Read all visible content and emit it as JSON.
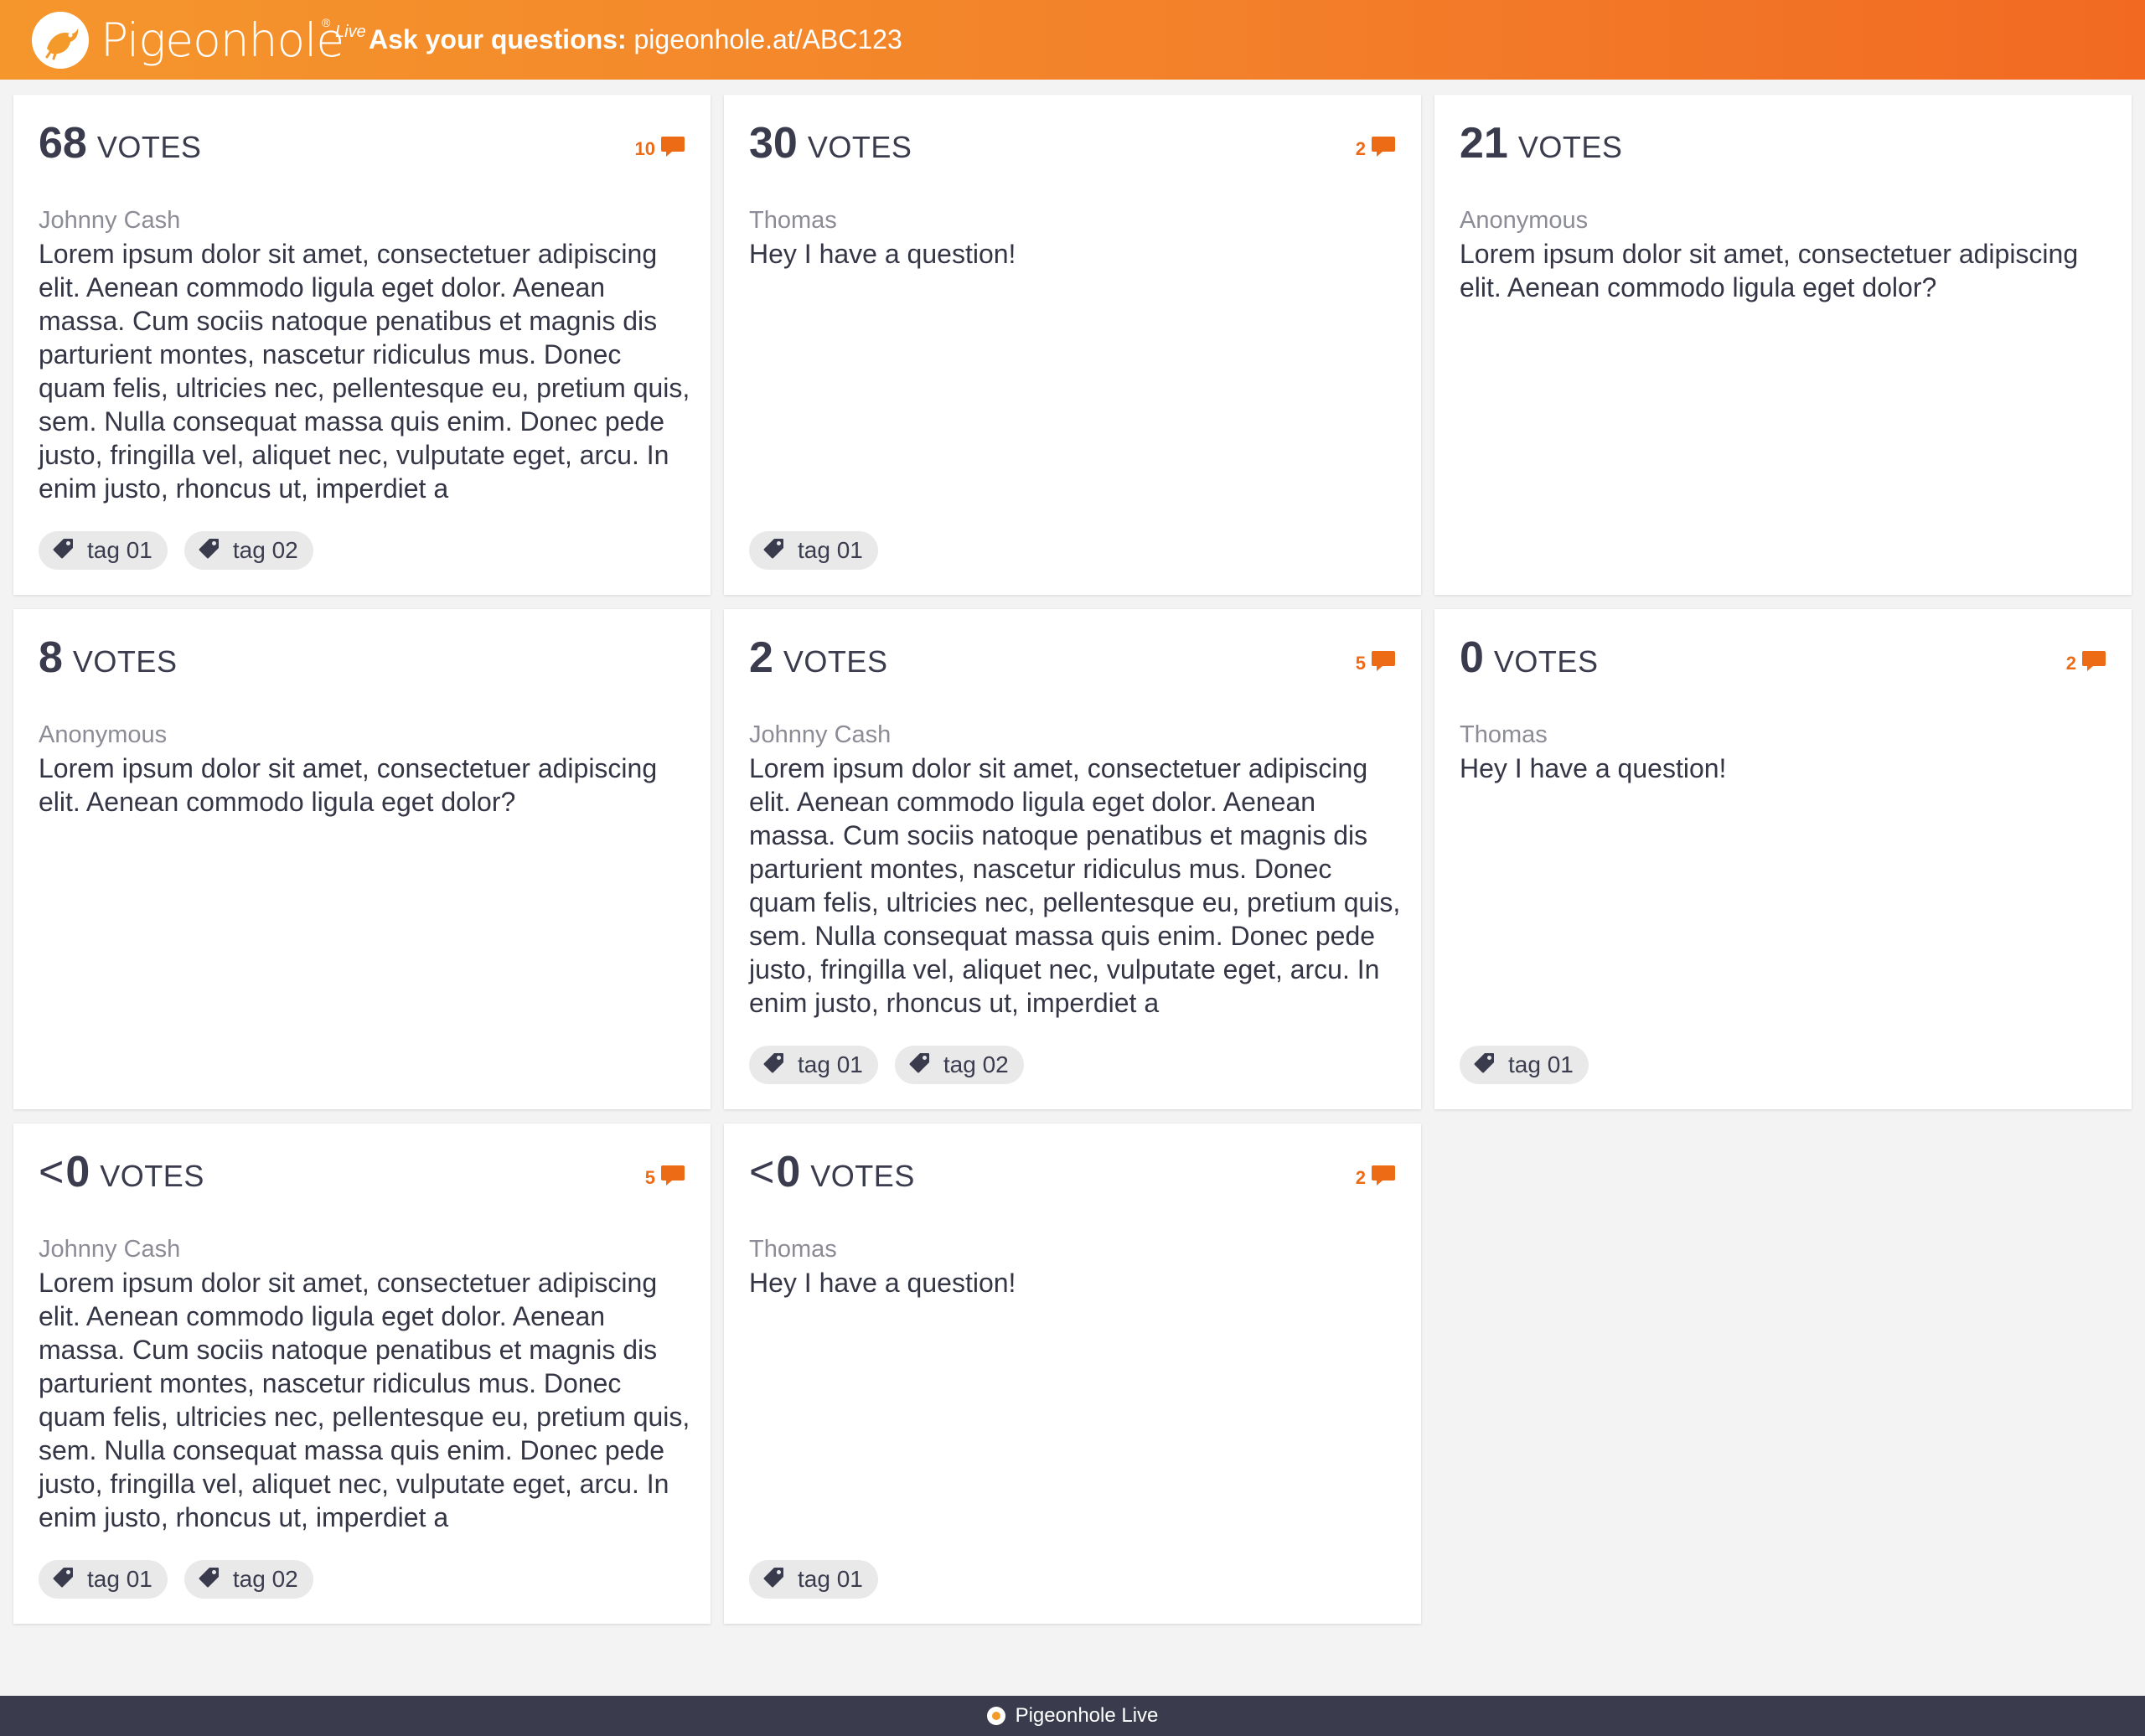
{
  "header": {
    "brand": "Pigeonhole",
    "brand_registered": "®",
    "brand_suffix": "Live",
    "ask_label": "Ask your questions:",
    "ask_url": "pigeonhole.at/ABC123"
  },
  "colors": {
    "header_gradient_start": "#f5962c",
    "header_gradient_end": "#f26a22",
    "accent": "#ee6b16",
    "footer": "#3a3c4e",
    "background": "#f3f3f3"
  },
  "votes_label": "VOTES",
  "cards": [
    {
      "prefix": "",
      "votes": "68",
      "comments": "10",
      "author": "Johnny Cash",
      "text": "Lorem ipsum dolor sit amet, consectetuer adipiscing elit. Aenean commodo ligula eget dolor. Aenean massa. Cum sociis natoque penatibus et magnis dis parturient montes, nascetur ridiculus mus. Donec quam felis, ultricies nec, pellentesque eu, pretium quis, sem. Nulla consequat massa quis enim. Donec pede justo, fringilla vel, aliquet nec, vulputate eget, arcu. In enim justo, rhoncus ut, imperdiet a",
      "tags": [
        "tag 01",
        "tag 02"
      ]
    },
    {
      "prefix": "",
      "votes": "30",
      "comments": "2",
      "author": "Thomas",
      "text": "Hey I have a question!",
      "tags": [
        "tag 01"
      ]
    },
    {
      "prefix": "",
      "votes": "21",
      "comments": "",
      "author": "Anonymous",
      "text": "Lorem ipsum dolor sit amet, consectetuer adipiscing elit. Aenean commodo ligula eget dolor?",
      "tags": []
    },
    {
      "prefix": "",
      "votes": "8",
      "comments": "",
      "author": "Anonymous",
      "text": "Lorem ipsum dolor sit amet, consectetuer adipiscing elit. Aenean commodo ligula eget dolor?",
      "tags": []
    },
    {
      "prefix": "",
      "votes": "2",
      "comments": "5",
      "author": "Johnny Cash",
      "text": "Lorem ipsum dolor sit amet, consectetuer adipiscing elit. Aenean commodo ligula eget dolor. Aenean massa. Cum sociis natoque penatibus et magnis dis parturient montes, nascetur ridiculus mus. Donec quam felis, ultricies nec, pellentesque eu, pretium quis, sem. Nulla consequat massa quis enim. Donec pede justo, fringilla vel, aliquet nec, vulputate eget, arcu. In enim justo, rhoncus ut, imperdiet a",
      "tags": [
        "tag 01",
        "tag 02"
      ]
    },
    {
      "prefix": "",
      "votes": "0",
      "comments": "2",
      "author": "Thomas",
      "text": "Hey I have a question!",
      "tags": [
        "tag 01"
      ]
    },
    {
      "prefix": "<",
      "votes": "0",
      "comments": "5",
      "author": "Johnny Cash",
      "text": "Lorem ipsum dolor sit amet, consectetuer adipiscing elit. Aenean commodo ligula eget dolor. Aenean massa. Cum sociis natoque penatibus et magnis dis parturient montes, nascetur ridiculus mus. Donec quam felis, ultricies nec, pellentesque eu, pretium quis, sem. Nulla consequat massa quis enim. Donec pede justo, fringilla vel, aliquet nec, vulputate eget, arcu. In enim justo, rhoncus ut, imperdiet a",
      "tags": [
        "tag 01",
        "tag 02"
      ]
    },
    {
      "prefix": "<",
      "votes": "0",
      "comments": "2",
      "author": "Thomas",
      "text": "Hey I have a question!",
      "tags": [
        "tag 01"
      ]
    }
  ],
  "footer": {
    "label": "Pigeonhole Live"
  }
}
